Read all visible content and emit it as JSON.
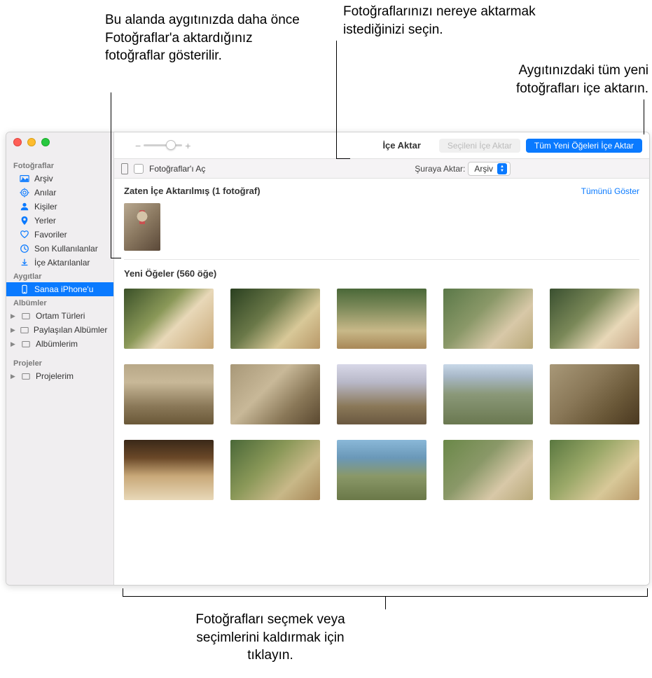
{
  "callouts": {
    "already_imported": "Bu alanda aygıtınızda daha önce Fotoğraflar'a aktardığınız fotoğraflar gösterilir.",
    "destination": "Fotoğraflarınızı nereye aktarmak istediğinizi seçin.",
    "import_all": "Aygıtınızdaki tüm yeni fotoğrafları içe aktarın.",
    "select_photos": "Fotoğrafları seçmek veya seçimlerini kaldırmak için tıklayın."
  },
  "sidebar": {
    "sections": {
      "photos": "Fotoğraflar",
      "devices": "Aygıtlar",
      "albums": "Albümler",
      "projects": "Projeler"
    },
    "items": {
      "library": "Arşiv",
      "memories": "Anılar",
      "people": "Kişiler",
      "places": "Yerler",
      "favorites": "Favoriler",
      "recents": "Son Kullanılanlar",
      "imports": "İçe Aktarılanlar",
      "device": "Sanaa iPhone'u",
      "media_types": "Ortam Türleri",
      "shared_albums": "Paylaşılan Albümler",
      "my_albums": "Albümlerim",
      "my_projects": "Projelerim"
    }
  },
  "toolbar": {
    "title": "İçe Aktar",
    "import_selected": "Seçileni İçe Aktar",
    "import_all_new": "Tüm Yeni Öğeleri İçe Aktar"
  },
  "subtoolbar": {
    "open_photos": "Fotoğraflar'ı Aç",
    "import_to_label": "Şuraya Aktar:",
    "import_to_value": "Arşiv"
  },
  "content": {
    "already_imported_title": "Zaten İçe Aktarılmış (1 fotoğraf)",
    "show_all": "Tümünü Göster",
    "new_items_title": "Yeni Öğeler (560 öğe)"
  }
}
